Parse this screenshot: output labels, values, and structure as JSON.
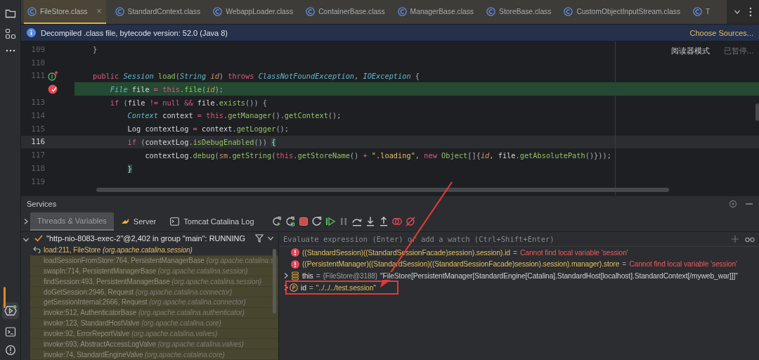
{
  "file_tabs": [
    {
      "label": "FileStore.class",
      "selected": true,
      "close": "×"
    },
    {
      "label": "StandardContext.class",
      "selected": false
    },
    {
      "label": "WebappLoader.class",
      "selected": false
    },
    {
      "label": "ContainerBase.class",
      "selected": false
    },
    {
      "label": "ManagerBase.class",
      "selected": false
    },
    {
      "label": "StoreBase.class",
      "selected": false
    },
    {
      "label": "CustomObjectInputStream.class",
      "selected": false
    },
    {
      "label": "T",
      "selected": false
    }
  ],
  "banner": {
    "text": "Decompiled .class file, bytecode version: 52.0 (Java 8)",
    "action": "Choose Sources..."
  },
  "editor": {
    "reader_mode": "阅读器模式",
    "paused": "已暂停...",
    "lines": [
      {
        "number": "109",
        "kind": "normal",
        "tokens": [
          {
            "kind": "punct",
            "text": "}"
          }
        ]
      },
      {
        "number": "110",
        "kind": "normal"
      },
      {
        "number": "111",
        "kind": "normal",
        "gutter": {
          "kind": "implements"
        },
        "tokens": [
          {
            "kind": "keyword",
            "text": "public "
          },
          {
            "kind": "type",
            "text": "Session "
          },
          {
            "kind": "method",
            "text": "load"
          },
          {
            "kind": "punct",
            "text": "("
          },
          {
            "kind": "type",
            "text": "String "
          },
          {
            "kind": "param",
            "text": "id"
          },
          {
            "kind": "punct",
            "text": ") "
          },
          {
            "kind": "keyword",
            "text": "throws "
          },
          {
            "kind": "type",
            "text": "ClassNotFoundException"
          },
          {
            "kind": "punct",
            "text": ", "
          },
          {
            "kind": "type",
            "text": "IOException "
          },
          {
            "kind": "punct",
            "text": "{"
          }
        ]
      },
      {
        "kind": "execution",
        "gutter": {
          "kind": "breakpoint"
        },
        "tokens": [
          {
            "kind": "type",
            "text": "    File"
          },
          {
            "kind": "plain",
            "text": " file "
          },
          {
            "kind": "keyword",
            "text": "= this"
          },
          {
            "kind": "punct",
            "text": "."
          },
          {
            "kind": "method",
            "text": "file"
          },
          {
            "kind": "punct",
            "text": "("
          },
          {
            "kind": "param",
            "text": "id"
          },
          {
            "kind": "punct",
            "text": ");"
          }
        ]
      },
      {
        "number": "113",
        "kind": "normal",
        "tokens": [
          {
            "kind": "keyword",
            "text": "    if "
          },
          {
            "kind": "punct",
            "text": "("
          },
          {
            "kind": "plain",
            "text": "file "
          },
          {
            "kind": "keyword",
            "text": "!= null && "
          },
          {
            "kind": "plain",
            "text": "file"
          },
          {
            "kind": "punct",
            "text": "."
          },
          {
            "kind": "method",
            "text": "exists"
          },
          {
            "kind": "punct",
            "text": "()) {"
          }
        ]
      },
      {
        "number": "114",
        "kind": "normal",
        "tokens": [
          {
            "kind": "type",
            "text": "        Context"
          },
          {
            "kind": "plain",
            "text": " context "
          },
          {
            "kind": "keyword",
            "text": "= this"
          },
          {
            "kind": "punct",
            "text": "."
          },
          {
            "kind": "method",
            "text": "getManager"
          },
          {
            "kind": "punct",
            "text": "()."
          },
          {
            "kind": "method",
            "text": "getContext"
          },
          {
            "kind": "punct",
            "text": "();"
          }
        ]
      },
      {
        "number": "115",
        "kind": "normal",
        "tokens": [
          {
            "kind": "plain",
            "text": "        Log contextLog "
          },
          {
            "kind": "keyword",
            "text": "= "
          },
          {
            "kind": "plain",
            "text": "context"
          },
          {
            "kind": "punct",
            "text": "."
          },
          {
            "kind": "method",
            "text": "getLogger"
          },
          {
            "kind": "punct",
            "text": "();"
          }
        ]
      },
      {
        "number": "116",
        "kind": "caret",
        "tokens": [
          {
            "kind": "keyword",
            "text": "        if "
          },
          {
            "kind": "punct",
            "text": "("
          },
          {
            "kind": "plain",
            "text": "contextLog"
          },
          {
            "kind": "punct",
            "text": "."
          },
          {
            "kind": "method",
            "text": "isDebugEnabled"
          },
          {
            "kind": "punct",
            "text": "()) "
          },
          {
            "kind": "brace",
            "text": "{"
          }
        ]
      },
      {
        "number": "117",
        "kind": "normal",
        "tokens": [
          {
            "kind": "plain",
            "text": "            contextLog"
          },
          {
            "kind": "punct",
            "text": "."
          },
          {
            "kind": "method",
            "text": "debug"
          },
          {
            "kind": "punct",
            "text": "("
          },
          {
            "kind": "field",
            "text": "sm"
          },
          {
            "kind": "punct",
            "text": "."
          },
          {
            "kind": "method",
            "text": "getString"
          },
          {
            "kind": "punct",
            "text": "("
          },
          {
            "kind": "keyword",
            "text": "this"
          },
          {
            "kind": "punct",
            "text": "."
          },
          {
            "kind": "method",
            "text": "getStoreName"
          },
          {
            "kind": "punct",
            "text": "() "
          },
          {
            "kind": "keyword",
            "text": "+ "
          },
          {
            "kind": "string",
            "text": "\".loading\""
          },
          {
            "kind": "punct",
            "text": ", "
          },
          {
            "kind": "keyword",
            "text": "new "
          },
          {
            "kind": "method",
            "text": "Object"
          },
          {
            "kind": "punct",
            "text": "[]{"
          },
          {
            "kind": "param",
            "text": "id"
          },
          {
            "kind": "punct",
            "text": ", "
          },
          {
            "kind": "plain",
            "text": "file"
          },
          {
            "kind": "punct",
            "text": "."
          },
          {
            "kind": "method",
            "text": "getAbsolutePath"
          },
          {
            "kind": "punct",
            "text": "()}));"
          }
        ]
      },
      {
        "number": "118",
        "kind": "normal",
        "tokens": [
          {
            "kind": "brace",
            "text": "        }"
          }
        ]
      },
      {
        "number": "119",
        "kind": "normal"
      }
    ]
  },
  "services": {
    "title": "Services",
    "tabs": [
      {
        "label": "Threads & Variables",
        "selected": true
      },
      {
        "label": "Server",
        "selected": false
      },
      {
        "label": "Tomcat Catalina Log",
        "selected": false
      }
    ],
    "thread": {
      "label": "\"http-nio-8083-exec-2\"@2,402 in group \"main\": RUNNING",
      "expanded": true
    },
    "frames": [
      {
        "location": "load:211, FileStore",
        "package": "(org.apache.catalina.session)",
        "selected": true
      },
      {
        "location": "loadSessionFromStore:764, PersistentManagerBase",
        "package": "(org.apache.catalina.s",
        "selected": false
      },
      {
        "location": "swapIn:714, PersistentManagerBase",
        "package": "(org.apache.catalina.session)",
        "selected": false
      },
      {
        "location": "findSession:493, PersistentManagerBase",
        "package": "(org.apache.catalina.session)",
        "selected": false
      },
      {
        "location": "doGetSession:2946, Request",
        "package": "(org.apache.catalina.connector)",
        "selected": false
      },
      {
        "location": "getSessionInternal:2666, Request",
        "package": "(org.apache.catalina.connector)",
        "selected": false
      },
      {
        "location": "invoke:512, AuthenticatorBase",
        "package": "(org.apache.catalina.authenticator)",
        "selected": false
      },
      {
        "location": "invoke:123, StandardHostValve",
        "package": "(org.apache.catalina.core)",
        "selected": false
      },
      {
        "location": "invoke:92, ErrorReportValve",
        "package": "(org.apache.catalina.valves)",
        "selected": false
      },
      {
        "location": "invoke:693, AbstractAccessLogValve",
        "package": "(org.apache.catalina.valves)",
        "selected": false
      },
      {
        "location": "invoke:74, StandardEngineValve",
        "package": "(org.apache.catalina.core)",
        "selected": false
      }
    ],
    "evaluate": {
      "placeholder": "Evaluate expression (Enter) or add a watch (Ctrl+Shift+Enter)"
    },
    "variables": [
      {
        "kind": "error",
        "name": "((StandardSession)((StandardSessionFacade)session).session).id",
        "equals": "=",
        "value": "Cannot find local variable 'session'",
        "annotated": false
      },
      {
        "kind": "error",
        "name": "((PersistentManager)((StandardSession)((StandardSessionFacade)session).session).manager).store",
        "equals": "=",
        "value": "Cannot find local variable 'session'",
        "annotated": false
      },
      {
        "kind": "object",
        "name": "this",
        "equals": "=",
        "type": "{FileStore@3188}",
        "value": "\"FileStore[PersistentManager[StandardEngine[Catalina].StandardHost[localhost].StandardContext[/myweb_war]]]\"",
        "expanded": false,
        "annotated": false
      },
      {
        "kind": "param",
        "name": "id",
        "equals": "=",
        "value": "\"../../../test.session\"",
        "expanded": false,
        "annotated": true
      }
    ]
  }
}
